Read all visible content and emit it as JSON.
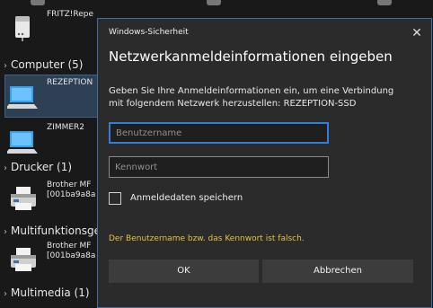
{
  "explorer": {
    "top_item": {
      "label": "FRITZ!Repe",
      "icon": "router-icon"
    },
    "groups": [
      {
        "label": "Computer (5)"
      },
      {
        "label": "Drucker (1)"
      },
      {
        "label": "Multifunktionsge"
      },
      {
        "label": "Multimedia (1)"
      }
    ],
    "computers": [
      {
        "label": "REZEPTION",
        "selected": true,
        "icon": "computer-icon"
      },
      {
        "label": "ZIMMER2",
        "selected": false,
        "icon": "computer-icon"
      }
    ],
    "printer": {
      "line1": "Brother MF",
      "line2": "[001ba9a8a",
      "icon": "printer-icon"
    },
    "multifunction": {
      "line1": "Brother MF",
      "line2": "[001ba9a8a",
      "icon": "printer-icon"
    }
  },
  "dialog": {
    "window_title": "Windows-Sicherheit",
    "close_symbol": "✕",
    "heading": "Netzwerkanmeldeinformationen eingeben",
    "description_line1": "Geben Sie Ihre Anmeldeinformationen ein, um eine Verbindung",
    "description_line2": "mit folgendem Netzwerk herzustellen: REZEPTION-SSD",
    "username": {
      "value": "",
      "placeholder": "Benutzername"
    },
    "password": {
      "value": "",
      "placeholder": "Kennwort"
    },
    "remember": {
      "label": "Anmeldedaten speichern",
      "checked": false
    },
    "error": "Der Benutzername bzw. das Kennwort ist falsch.",
    "ok_label": "OK",
    "cancel_label": "Abbrechen",
    "colors": {
      "accent": "#2f7fd9",
      "error": "#e6c23c",
      "background": "#2b2b2b"
    }
  }
}
